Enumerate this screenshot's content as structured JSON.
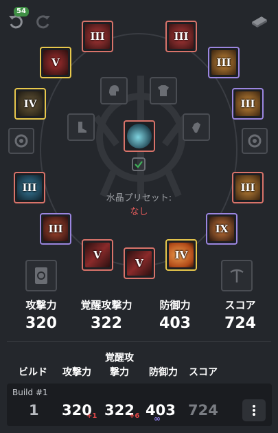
{
  "top": {
    "undo_icon": "undo-icon",
    "redo_icon": "redo-icon",
    "undo_count": "54",
    "share_icon": "card-icon"
  },
  "crystal_preset": {
    "label": "水晶プリセット:",
    "value": "なし"
  },
  "slots": [
    {
      "name": "left-helmet-slot",
      "tier": "III",
      "frame": "red",
      "art": "#8c2b2b"
    },
    {
      "name": "right-armor-slot",
      "tier": "III",
      "frame": "red",
      "art": "#8c2b2b"
    },
    {
      "name": "left-necklace-slot",
      "tier": "V",
      "frame": "gold",
      "art": "#7a2a2a"
    },
    {
      "name": "right-ring-upper-slot",
      "tier": "III",
      "frame": "purple",
      "art": "#a5652b"
    },
    {
      "name": "left-bow-slot",
      "tier": "IV",
      "frame": "gold",
      "art": "#4a3a22"
    },
    {
      "name": "right-ring-lower-slot",
      "tier": "III",
      "frame": "purple",
      "art": "#a5652b"
    },
    {
      "name": "left-gloves-slot",
      "tier": "III",
      "frame": "red",
      "art": "#2e5a73"
    },
    {
      "name": "right-gloves-slot",
      "tier": "III",
      "frame": "red",
      "art": "#a86b2b"
    },
    {
      "name": "left-belt-slot",
      "tier": "III",
      "frame": "purple",
      "art": "#8a3a2a"
    },
    {
      "name": "right-earring-slot",
      "tier": "IX",
      "frame": "purple",
      "art": "#b05a2a"
    },
    {
      "name": "main-weapon-slot",
      "tier": "V",
      "frame": "red",
      "art": "#4a1c1c"
    },
    {
      "name": "awakening-weapon-slot",
      "tier": "V",
      "frame": "red",
      "art": "#4a1c1c"
    },
    {
      "name": "sub-weapon-slot",
      "tier": "IV",
      "frame": "gold",
      "art": "#d8722b"
    }
  ],
  "stats": {
    "ap_label": "攻撃力",
    "ap_value": "320",
    "aap_label": "覚醒攻撃力",
    "aap_value": "322",
    "dp_label": "防御力",
    "dp_value": "403",
    "score_label": "スコア",
    "score_value": "724"
  },
  "builds_table": {
    "headers": {
      "build": "ビルド",
      "ap": "攻撃力",
      "aap_line1": "覚醒攻",
      "aap_line2": "撃力",
      "dp": "防御力",
      "score": "スコア"
    },
    "rows": [
      {
        "title": "Build #1",
        "index": "1",
        "ap": "320",
        "ap_delta": "+1",
        "aap": "322",
        "aap_delta": "+6",
        "dp": "403",
        "dp_delta": "∞",
        "score": "724",
        "menu_icon": "more-vertical-icon"
      }
    ]
  },
  "colors": {
    "red_frame": "#d9736a",
    "purple_frame": "#9b86e0",
    "gold_frame": "#e8c84c",
    "delta_red": "#e04848",
    "delta_purple": "#8a7ae0",
    "crystal_value": "#e05a5a"
  }
}
